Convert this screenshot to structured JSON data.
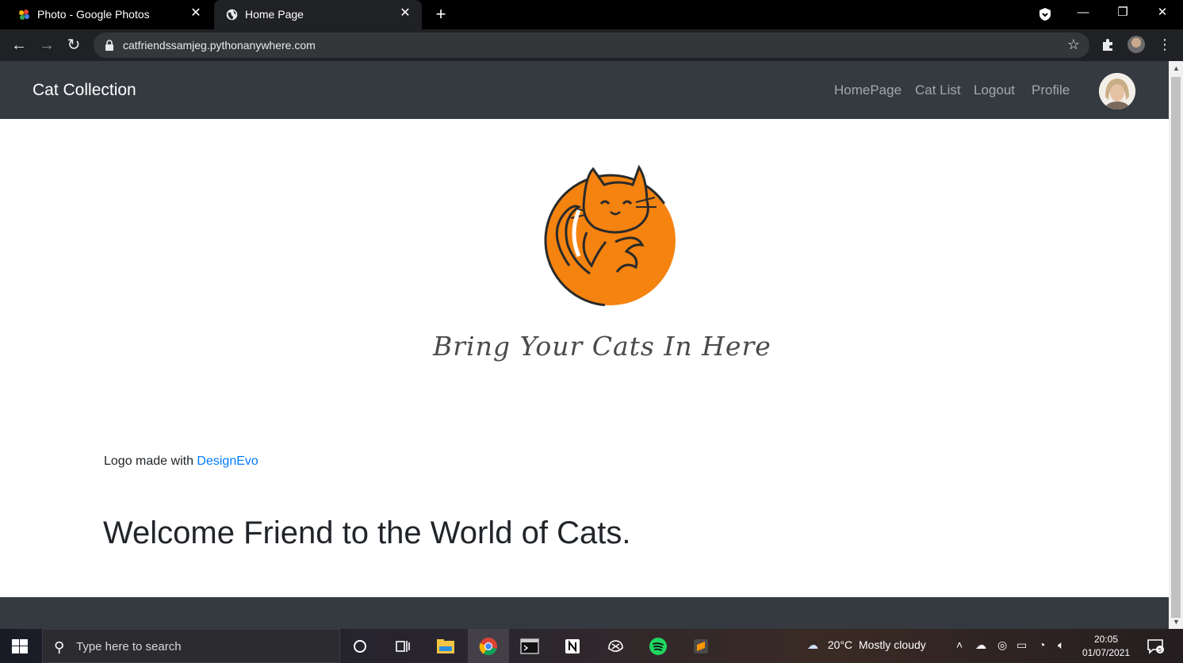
{
  "browser": {
    "tabs": [
      {
        "title": "Photo - Google Photos",
        "active": false
      },
      {
        "title": "Home Page",
        "active": true
      }
    ],
    "url": "catfriendssamjeg.pythonanywhere.com"
  },
  "site": {
    "brand": "Cat Collection",
    "nav": [
      "HomePage",
      "Cat List",
      "Logout",
      "Profile"
    ],
    "tagline": "Bring Your Cats In Here",
    "credit_prefix": "Logo made with ",
    "credit_link": "DesignEvo",
    "welcome": "Welcome Friend to the World of Cats."
  },
  "taskbar": {
    "search_placeholder": "Type here to search",
    "weather_temp": "20°C",
    "weather_text": "Mostly cloudy",
    "time": "20:05",
    "date": "01/07/2021",
    "notification_count": "5"
  },
  "colors": {
    "navbar": "#343a40",
    "cat_orange": "#f5830f",
    "link": "#007bff"
  }
}
